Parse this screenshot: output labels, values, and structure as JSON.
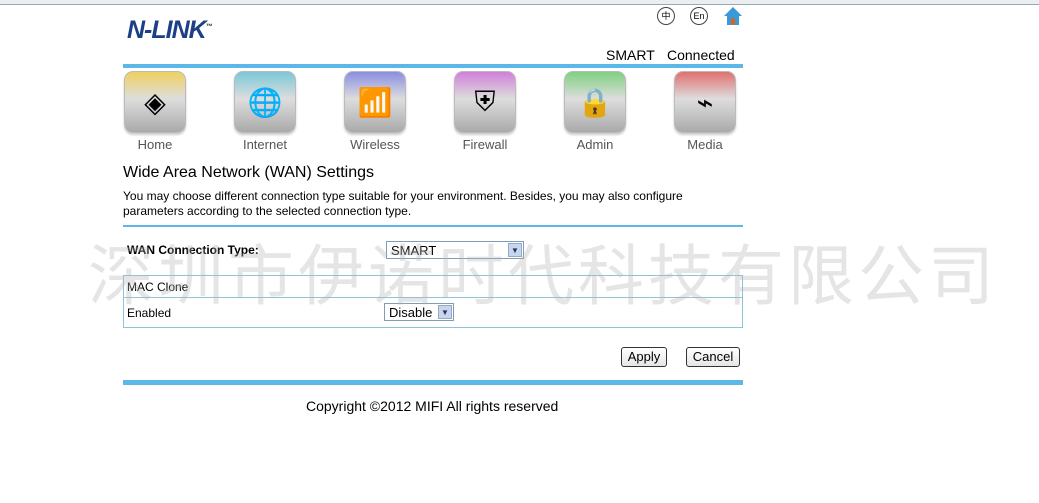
{
  "header": {
    "logo": "N-LINK",
    "tm": "™",
    "lang_zh": "中",
    "lang_en": "En",
    "mode": "SMART",
    "status": "Connected"
  },
  "nav": [
    {
      "label": "Home",
      "icon": "home-router-icon",
      "color": "#f0d060"
    },
    {
      "label": "Internet",
      "icon": "globe-check-icon",
      "color": "#7cc8d8"
    },
    {
      "label": "Wireless",
      "icon": "wireless-antenna-icon",
      "color": "#8a8fe0"
    },
    {
      "label": "Firewall",
      "icon": "shield-icon",
      "color": "#d080d8"
    },
    {
      "label": "Admin",
      "icon": "padlock-gear-icon",
      "color": "#80d080"
    },
    {
      "label": "Media",
      "icon": "usb-wireless-icon",
      "color": "#e07070"
    }
  ],
  "page": {
    "title": "Wide Area Network (WAN) Settings",
    "description": "You may choose different connection type suitable for your environment. Besides, you may also configure parameters according to the selected connection type."
  },
  "form": {
    "wan_label": "WAN Connection Type:",
    "wan_value": "SMART",
    "mac_clone_header": "MAC Clone",
    "enabled_label": "Enabled",
    "enabled_value": "Disable",
    "apply": "Apply",
    "cancel": "Cancel"
  },
  "watermark": "深圳市伊诺时代科技有限公司",
  "footer": {
    "copyright": "Copyright ©2012 MIFI All rights reserved"
  }
}
